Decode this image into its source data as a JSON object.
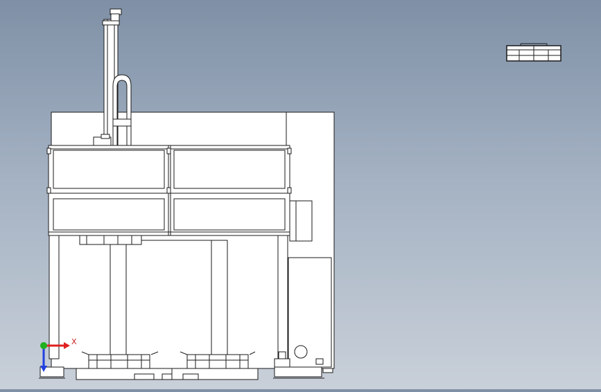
{
  "viewport": {
    "background_top": "#7f90a6",
    "background_bottom": "#c9d0d9",
    "line_color": "#1a1a1a",
    "part_fill": "#ffffff"
  },
  "triad": {
    "x_label": "X",
    "x_color": "#e02020",
    "y_color": "#20b020",
    "z_color": "#2040e0"
  },
  "view_cube": {
    "icon": "view-orientation-cube-icon"
  }
}
